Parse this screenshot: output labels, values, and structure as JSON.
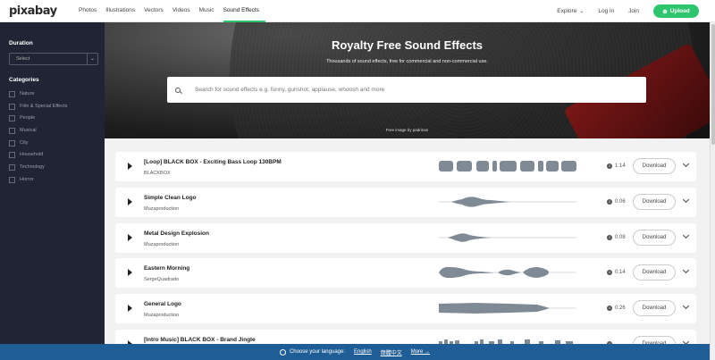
{
  "header": {
    "logo": "pixabay",
    "nav": [
      "Photos",
      "Illustrations",
      "Vectors",
      "Videos",
      "Music",
      "Sound Effects"
    ],
    "active_nav": "Sound Effects",
    "explore": "Explore",
    "login": "Log in",
    "join": "Join",
    "upload": "Upload"
  },
  "sidebar": {
    "duration_label": "Duration",
    "duration_select": "Select",
    "categories_label": "Categories",
    "categories": [
      "Nature",
      "Film & Special Effects",
      "People",
      "Musical",
      "City",
      "Household",
      "Technology",
      "Horror"
    ]
  },
  "hero": {
    "title": "Royalty Free Sound Effects",
    "subtitle": "Thousands of sound effects, free for commercial and non-commercial use.",
    "search_placeholder": "Search for sound effects e.g. funny, gunshot, applause, whoosh and more",
    "credit": "Free image by padrinan"
  },
  "tracks": [
    {
      "title": "[Loop] BLACK BOX - Exciting Bass Loop 130BPM",
      "author": "BLACKBOX",
      "duration": "1:14",
      "download": "Download"
    },
    {
      "title": "Simple Clean Logo",
      "author": "Muzaproduction",
      "duration": "0:06",
      "download": "Download"
    },
    {
      "title": "Metal Design Explosion",
      "author": "Muzaproduction",
      "duration": "0:08",
      "download": "Download"
    },
    {
      "title": "Eastern Morning",
      "author": "SergeQuadrado",
      "duration": "0:14",
      "download": "Download"
    },
    {
      "title": "General Logo",
      "author": "Muzaproduction",
      "duration": "0:26",
      "download": "Download"
    },
    {
      "title": "[Intro Music] BLACK BOX - Brand Jingle",
      "author": "",
      "duration": "",
      "download": "Download"
    }
  ],
  "language_bar": {
    "prompt": "Choose your language:",
    "lang1": "English",
    "lang2": "簡體中文",
    "more": "More →"
  },
  "colors": {
    "accent": "#2ec66d",
    "sidebar_bg": "#202434",
    "lang_bar": "#1f5d96"
  }
}
